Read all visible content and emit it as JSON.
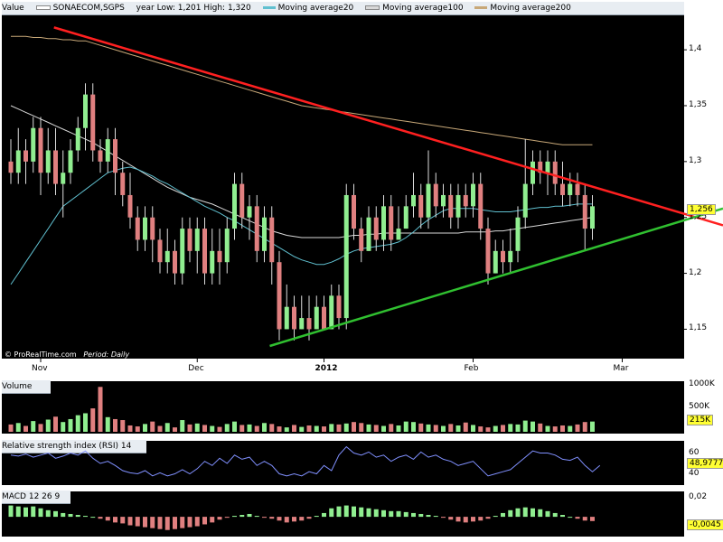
{
  "chart_data": {
    "type": "candlestick",
    "title": "SONAECOM,SGPS",
    "legend": {
      "value_label": "Value",
      "series_name": "SONAECOM,SGPS",
      "range_text": "year Low: 1,201 High: 1,320",
      "ma20": "Moving average20",
      "ma100": "Moving average100",
      "ma200": "Moving average200"
    },
    "colors": {
      "up": "#90ee90",
      "down": "#e08080",
      "ma20": "#60c0d0",
      "ma100": "#d8d8d8",
      "ma200": "#c8a878",
      "resistance": "#ff2020",
      "support": "#30c030"
    },
    "price_axis": {
      "ticks": [
        "1,4",
        "1,35",
        "1,3",
        "1,25",
        "1,2",
        "1,15"
      ],
      "ylim": [
        1.135,
        1.43
      ],
      "last_price": "1,256"
    },
    "x_ticks": [
      {
        "label": "Nov",
        "index": 4
      },
      {
        "label": "Dec",
        "index": 25
      },
      {
        "label": "2012",
        "index": 42
      },
      {
        "label": "Feb",
        "index": 62
      },
      {
        "label": "Mar",
        "index": 82
      }
    ],
    "candles": [
      [
        1.3,
        1.29,
        1.32,
        1.28
      ],
      [
        1.29,
        1.31,
        1.33,
        1.28
      ],
      [
        1.31,
        1.3,
        1.32,
        1.28
      ],
      [
        1.3,
        1.33,
        1.34,
        1.29
      ],
      [
        1.33,
        1.29,
        1.34,
        1.27
      ],
      [
        1.29,
        1.31,
        1.33,
        1.28
      ],
      [
        1.31,
        1.28,
        1.33,
        1.27
      ],
      [
        1.28,
        1.29,
        1.31,
        1.25
      ],
      [
        1.29,
        1.31,
        1.32,
        1.28
      ],
      [
        1.31,
        1.33,
        1.34,
        1.3
      ],
      [
        1.33,
        1.36,
        1.37,
        1.31
      ],
      [
        1.36,
        1.31,
        1.37,
        1.3
      ],
      [
        1.31,
        1.3,
        1.32,
        1.29
      ],
      [
        1.3,
        1.32,
        1.33,
        1.29
      ],
      [
        1.32,
        1.29,
        1.33,
        1.27
      ],
      [
        1.29,
        1.27,
        1.3,
        1.26
      ],
      [
        1.27,
        1.25,
        1.29,
        1.24
      ],
      [
        1.25,
        1.23,
        1.26,
        1.22
      ],
      [
        1.23,
        1.25,
        1.26,
        1.22
      ],
      [
        1.25,
        1.23,
        1.26,
        1.21
      ],
      [
        1.23,
        1.21,
        1.24,
        1.2
      ],
      [
        1.21,
        1.22,
        1.24,
        1.2
      ],
      [
        1.22,
        1.2,
        1.23,
        1.19
      ],
      [
        1.2,
        1.24,
        1.25,
        1.19
      ],
      [
        1.24,
        1.22,
        1.25,
        1.21
      ],
      [
        1.22,
        1.24,
        1.25,
        1.2
      ],
      [
        1.24,
        1.2,
        1.25,
        1.19
      ],
      [
        1.2,
        1.22,
        1.24,
        1.19
      ],
      [
        1.22,
        1.21,
        1.24,
        1.19
      ],
      [
        1.21,
        1.24,
        1.25,
        1.2
      ],
      [
        1.24,
        1.28,
        1.29,
        1.23
      ],
      [
        1.28,
        1.25,
        1.29,
        1.24
      ],
      [
        1.25,
        1.26,
        1.27,
        1.23
      ],
      [
        1.26,
        1.22,
        1.27,
        1.21
      ],
      [
        1.22,
        1.25,
        1.26,
        1.21
      ],
      [
        1.25,
        1.21,
        1.26,
        1.19
      ],
      [
        1.21,
        1.15,
        1.22,
        1.14
      ],
      [
        1.15,
        1.17,
        1.19,
        1.15
      ],
      [
        1.17,
        1.15,
        1.18,
        1.14
      ],
      [
        1.15,
        1.16,
        1.18,
        1.15
      ],
      [
        1.16,
        1.15,
        1.18,
        1.14
      ],
      [
        1.15,
        1.17,
        1.18,
        1.15
      ],
      [
        1.17,
        1.15,
        1.18,
        1.15
      ],
      [
        1.15,
        1.18,
        1.19,
        1.15
      ],
      [
        1.18,
        1.16,
        1.19,
        1.15
      ],
      [
        1.16,
        1.27,
        1.28,
        1.15
      ],
      [
        1.27,
        1.24,
        1.28,
        1.23
      ],
      [
        1.24,
        1.22,
        1.25,
        1.21
      ],
      [
        1.22,
        1.25,
        1.26,
        1.22
      ],
      [
        1.25,
        1.23,
        1.26,
        1.22
      ],
      [
        1.23,
        1.26,
        1.27,
        1.22
      ],
      [
        1.26,
        1.23,
        1.27,
        1.22
      ],
      [
        1.23,
        1.24,
        1.26,
        1.23
      ],
      [
        1.24,
        1.26,
        1.27,
        1.24
      ],
      [
        1.26,
        1.27,
        1.29,
        1.25
      ],
      [
        1.27,
        1.25,
        1.28,
        1.24
      ],
      [
        1.25,
        1.28,
        1.31,
        1.24
      ],
      [
        1.28,
        1.26,
        1.29,
        1.25
      ],
      [
        1.26,
        1.27,
        1.28,
        1.25
      ],
      [
        1.27,
        1.25,
        1.28,
        1.24
      ],
      [
        1.25,
        1.27,
        1.28,
        1.24
      ],
      [
        1.27,
        1.26,
        1.28,
        1.25
      ],
      [
        1.26,
        1.28,
        1.29,
        1.25
      ],
      [
        1.28,
        1.24,
        1.29,
        1.23
      ],
      [
        1.24,
        1.2,
        1.25,
        1.19
      ],
      [
        1.2,
        1.22,
        1.23,
        1.2
      ],
      [
        1.22,
        1.21,
        1.23,
        1.2
      ],
      [
        1.21,
        1.22,
        1.24,
        1.2
      ],
      [
        1.22,
        1.25,
        1.26,
        1.21
      ],
      [
        1.25,
        1.28,
        1.32,
        1.24
      ],
      [
        1.28,
        1.3,
        1.31,
        1.27
      ],
      [
        1.3,
        1.29,
        1.31,
        1.28
      ],
      [
        1.29,
        1.3,
        1.31,
        1.27
      ],
      [
        1.3,
        1.28,
        1.31,
        1.27
      ],
      [
        1.28,
        1.27,
        1.3,
        1.26
      ],
      [
        1.27,
        1.28,
        1.29,
        1.26
      ],
      [
        1.28,
        1.27,
        1.29,
        1.26
      ],
      [
        1.27,
        1.24,
        1.28,
        1.22
      ],
      [
        1.24,
        1.26,
        1.27,
        1.23
      ]
    ],
    "ma20": [
      1.19,
      1.2,
      1.21,
      1.22,
      1.23,
      1.24,
      1.25,
      1.26,
      1.265,
      1.27,
      1.275,
      1.28,
      1.285,
      1.29,
      1.292,
      1.294,
      1.295,
      1.293,
      1.29,
      1.287,
      1.283,
      1.28,
      1.276,
      1.272,
      1.268,
      1.264,
      1.26,
      1.257,
      1.254,
      1.25,
      1.247,
      1.243,
      1.239,
      1.235,
      1.231,
      1.227,
      1.223,
      1.219,
      1.215,
      1.212,
      1.21,
      1.208,
      1.208,
      1.21,
      1.213,
      1.217,
      1.22,
      1.222,
      1.223,
      1.224,
      1.225,
      1.226,
      1.228,
      1.232,
      1.237,
      1.243,
      1.248,
      1.252,
      1.256,
      1.258,
      1.258,
      1.258,
      1.258,
      1.257,
      1.256,
      1.255,
      1.255,
      1.255,
      1.256,
      1.257,
      1.258,
      1.259,
      1.259,
      1.26,
      1.26,
      1.261,
      1.262,
      1.262,
      1.262
    ],
    "ma100": [
      1.35,
      1.347,
      1.344,
      1.341,
      1.338,
      1.335,
      1.332,
      1.329,
      1.326,
      1.323,
      1.32,
      1.317,
      1.313,
      1.309,
      1.305,
      1.301,
      1.297,
      1.293,
      1.289,
      1.285,
      1.281,
      1.277,
      1.274,
      1.271,
      1.268,
      1.266,
      1.264,
      1.262,
      1.259,
      1.256,
      1.253,
      1.25,
      1.247,
      1.244,
      1.241,
      1.238,
      1.236,
      1.234,
      1.233,
      1.232,
      1.232,
      1.232,
      1.232,
      1.232,
      1.232,
      1.233,
      1.234,
      1.234,
      1.235,
      1.235,
      1.236,
      1.236,
      1.236,
      1.236,
      1.236,
      1.236,
      1.236,
      1.236,
      1.236,
      1.236,
      1.236,
      1.237,
      1.237,
      1.237,
      1.237,
      1.238,
      1.238,
      1.239,
      1.24,
      1.241,
      1.242,
      1.243,
      1.244,
      1.245,
      1.246,
      1.247,
      1.248,
      1.249,
      1.25
    ],
    "ma200": [
      1.412,
      1.412,
      1.412,
      1.411,
      1.411,
      1.41,
      1.41,
      1.409,
      1.409,
      1.408,
      1.408,
      1.406,
      1.404,
      1.402,
      1.4,
      1.398,
      1.396,
      1.394,
      1.392,
      1.39,
      1.388,
      1.386,
      1.384,
      1.382,
      1.38,
      1.378,
      1.376,
      1.374,
      1.372,
      1.37,
      1.368,
      1.366,
      1.364,
      1.362,
      1.36,
      1.358,
      1.356,
      1.354,
      1.352,
      1.35,
      1.349,
      1.348,
      1.347,
      1.346,
      1.345,
      1.344,
      1.343,
      1.342,
      1.341,
      1.34,
      1.339,
      1.338,
      1.337,
      1.336,
      1.335,
      1.334,
      1.333,
      1.332,
      1.331,
      1.33,
      1.329,
      1.328,
      1.327,
      1.326,
      1.325,
      1.324,
      1.323,
      1.322,
      1.321,
      1.32,
      1.319,
      1.318,
      1.317,
      1.316,
      1.315,
      1.315,
      1.315,
      1.315,
      1.315
    ],
    "resistance": {
      "from": [
        0.07,
        1.42
      ],
      "to": [
        1.0,
        1.243
      ]
    },
    "support": {
      "from": [
        0.37,
        1.135
      ],
      "to": [
        1.0,
        1.258
      ]
    },
    "volume": {
      "title": "Volume",
      "ticks": [
        "1000K",
        "500K"
      ],
      "last": "215K",
      "max": 1000,
      "values": [
        150,
        180,
        120,
        220,
        160,
        250,
        310,
        200,
        260,
        340,
        380,
        480,
        920,
        300,
        260,
        240,
        130,
        110,
        160,
        210,
        120,
        180,
        90,
        240,
        150,
        170,
        140,
        120,
        100,
        160,
        210,
        140,
        150,
        120,
        180,
        160,
        110,
        90,
        140,
        100,
        130,
        120,
        110,
        160,
        150,
        170,
        200,
        180,
        150,
        140,
        120,
        160,
        130,
        210,
        200,
        170,
        150,
        140,
        120,
        160,
        130,
        190,
        140,
        110,
        90,
        120,
        140,
        160,
        150,
        230,
        210,
        170,
        120,
        110,
        130,
        120,
        150,
        200,
        210
      ]
    },
    "rsi": {
      "title": "Relative strength index (RSI) 14",
      "ticks": [
        "60",
        "40"
      ],
      "last": "48,9777",
      "ylim": [
        30,
        70
      ],
      "values": [
        58,
        57,
        59,
        56,
        58,
        60,
        55,
        57,
        60,
        58,
        62,
        55,
        50,
        52,
        48,
        43,
        41,
        40,
        43,
        38,
        41,
        38,
        40,
        44,
        40,
        45,
        52,
        48,
        55,
        50,
        58,
        54,
        56,
        48,
        52,
        48,
        40,
        38,
        40,
        38,
        42,
        40,
        48,
        43,
        58,
        66,
        60,
        58,
        61,
        56,
        58,
        52,
        56,
        58,
        54,
        61,
        56,
        58,
        54,
        52,
        48,
        50,
        52,
        45,
        38,
        40,
        42,
        44,
        50,
        56,
        62,
        60,
        60,
        58,
        54,
        53,
        56,
        48,
        42,
        48
      ]
    },
    "macd": {
      "title": "MACD 12 26 9",
      "ticks": [
        "0,02",
        "-0,0045"
      ],
      "last": "-0,0045",
      "ylim": [
        -0.02,
        0.025
      ],
      "values": [
        0.012,
        0.011,
        0.01,
        0.011,
        0.009,
        0.007,
        0.006,
        0.004,
        0.003,
        0.002,
        0.001,
        0.0,
        -0.002,
        -0.004,
        -0.006,
        -0.007,
        -0.009,
        -0.01,
        -0.011,
        -0.012,
        -0.013,
        -0.014,
        -0.013,
        -0.012,
        -0.011,
        -0.01,
        -0.008,
        -0.006,
        -0.003,
        -0.001,
        0.001,
        0.002,
        0.003,
        0.001,
        -0.001,
        -0.002,
        -0.004,
        -0.006,
        -0.005,
        -0.004,
        -0.002,
        0.001,
        0.004,
        0.009,
        0.011,
        0.012,
        0.011,
        0.01,
        0.009,
        0.008,
        0.007,
        0.006,
        0.006,
        0.005,
        0.004,
        0.003,
        0.002,
        0.001,
        -0.001,
        -0.003,
        -0.005,
        -0.006,
        -0.005,
        -0.004,
        -0.002,
        0.001,
        0.004,
        0.007,
        0.009,
        0.01,
        0.009,
        0.008,
        0.006,
        0.004,
        0.002,
        0.0,
        -0.002,
        -0.004,
        -0.0045
      ]
    },
    "footer": {
      "brand": "© ProRealTime.com",
      "period_label": "Period:",
      "period_value": "Daily"
    }
  }
}
